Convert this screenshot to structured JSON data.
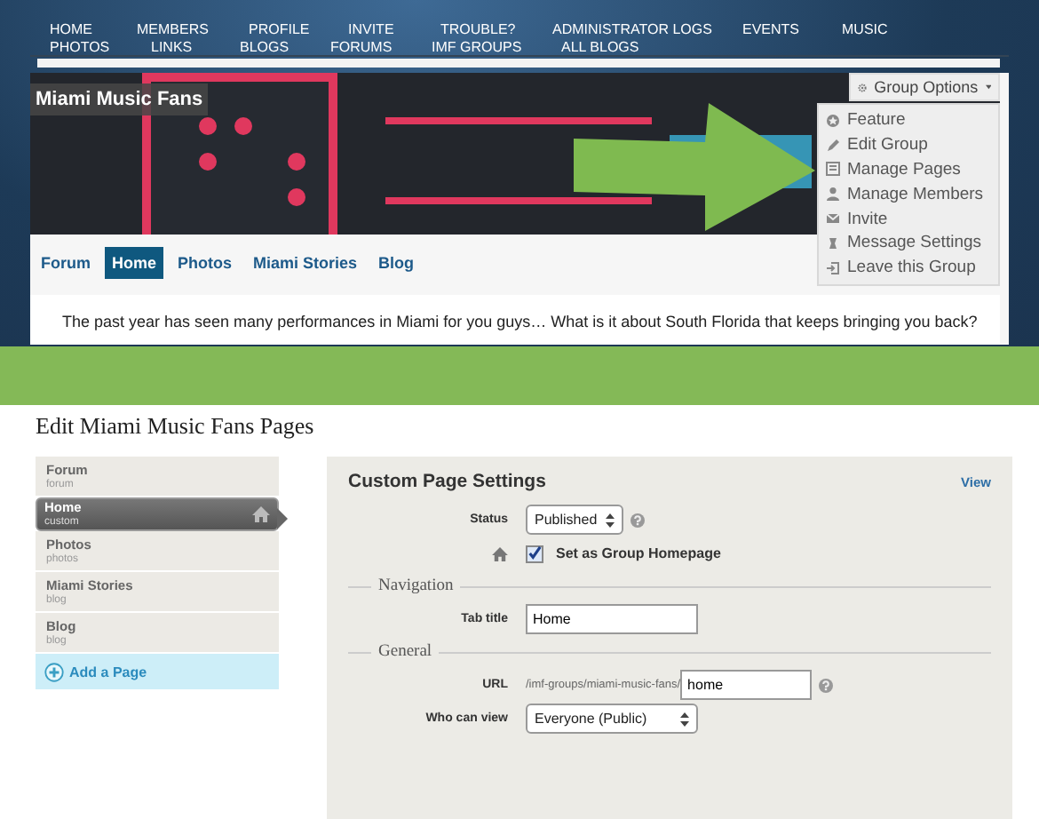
{
  "nav": {
    "rows": [
      [
        "HOME",
        "MEMBERS",
        "PROFILE",
        "INVITE",
        "TROUBLE?",
        "ADMINISTRATOR LOGS",
        "EVENTS",
        "MUSIC"
      ],
      [
        "PHOTOS",
        "LINKS",
        "BLOGS",
        "FORUMS",
        "IMF GROUPS",
        "ALL BLOGS"
      ]
    ]
  },
  "group": {
    "title": "Miami Music Fans",
    "options_button": "Group Options",
    "menu": [
      "Feature",
      "Edit Group",
      "Manage Pages",
      "Manage Members",
      "Invite",
      "Message Settings",
      "Leave this Group"
    ],
    "tabs": [
      {
        "label": "Forum",
        "selected": false
      },
      {
        "label": "Home",
        "selected": true
      },
      {
        "label": "Photos",
        "selected": false
      },
      {
        "label": "Miami Stories",
        "selected": false
      },
      {
        "label": "Blog",
        "selected": false
      }
    ],
    "intro": "The past year has seen many performances in Miami for you guys… What is it about South Florida that keeps bringing you back?"
  },
  "edit_pages": {
    "title": "Edit Miami Music Fans Pages",
    "pages": [
      {
        "name": "Forum",
        "slug": "forum",
        "selected": false
      },
      {
        "name": "Home",
        "slug": "custom",
        "selected": true
      },
      {
        "name": "Photos",
        "slug": "photos",
        "selected": false
      },
      {
        "name": "Miami Stories",
        "slug": "blog",
        "selected": false
      },
      {
        "name": "Blog",
        "slug": "blog",
        "selected": false
      }
    ],
    "add_page": "Add a Page",
    "settings": {
      "heading": "Custom Page Settings",
      "view_link": "View",
      "status": {
        "label": "Status",
        "value": "Published"
      },
      "homepage": {
        "label": "Set as Group Homepage",
        "checked": true
      },
      "navigation_legend": "Navigation",
      "tab_title": {
        "label": "Tab title",
        "value": "Home"
      },
      "general_legend": "General",
      "url": {
        "label": "URL",
        "prefix": "/imf-groups/miami-music-fans/",
        "value": "home"
      },
      "who_can_view": {
        "label": "Who can view",
        "value": "Everyone (Public)"
      }
    }
  }
}
